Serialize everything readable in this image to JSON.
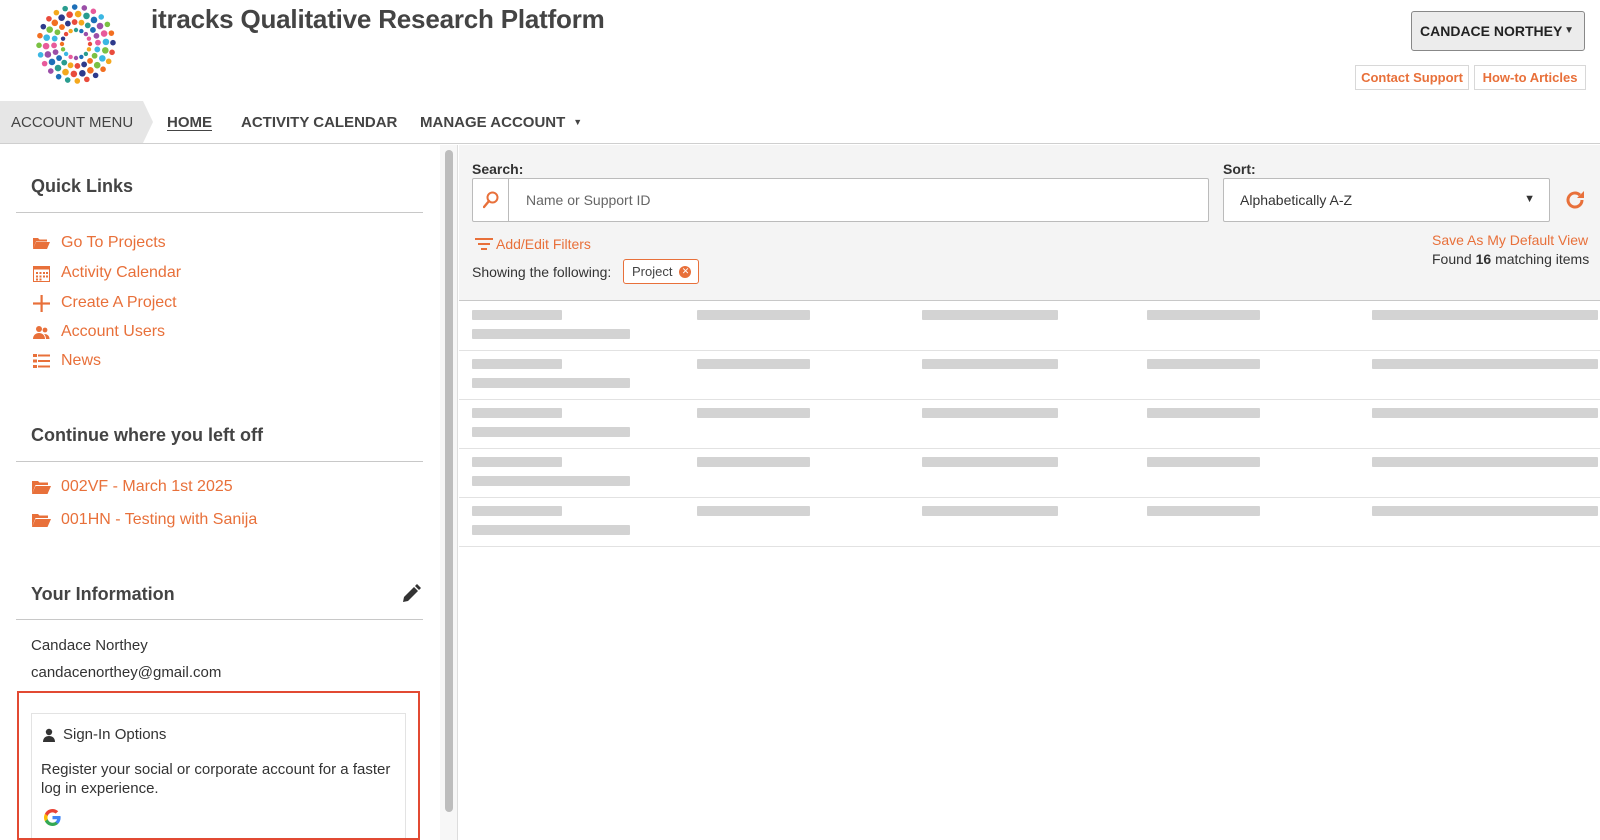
{
  "header": {
    "app_title": "itracks Qualitative Research Platform",
    "user_name": "CANDACE NORTHEY",
    "contact_support": "Contact Support",
    "how_to_articles": "How-to Articles"
  },
  "nav": {
    "account_menu": "ACCOUNT MENU",
    "items": [
      {
        "label": "HOME",
        "active": true
      },
      {
        "label": "ACTIVITY CALENDAR",
        "active": false
      },
      {
        "label": "MANAGE ACCOUNT",
        "active": false,
        "dropdown": true
      }
    ]
  },
  "quick_links": {
    "title": "Quick Links",
    "items": [
      {
        "label": "Go To Projects",
        "icon": "folder-open-icon"
      },
      {
        "label": "Activity Calendar",
        "icon": "calendar-icon"
      },
      {
        "label": "Create A Project",
        "icon": "plus-icon"
      },
      {
        "label": "Account Users",
        "icon": "users-icon"
      },
      {
        "label": "News",
        "icon": "list-icon"
      }
    ]
  },
  "continue": {
    "title": "Continue where you left off",
    "items": [
      {
        "label": "002VF - March 1st 2025",
        "icon": "folder-open-icon"
      },
      {
        "label": "001HN - Testing with Sanija",
        "icon": "folder-open-icon"
      }
    ]
  },
  "your_info": {
    "title": "Your Information",
    "name": "Candace Northey",
    "email": "candacenorthey@gmail.com",
    "signin": {
      "title": "Sign-In Options",
      "description": "Register your social or corporate account for a faster log in experience."
    }
  },
  "search": {
    "label": "Search:",
    "placeholder": "Name or Support ID",
    "value": ""
  },
  "sort": {
    "label": "Sort:",
    "selected": "Alphabetically A-Z"
  },
  "filters": {
    "add_edit_label": "Add/Edit Filters",
    "showing_label": "Showing the following:",
    "chips": [
      "Project"
    ]
  },
  "results": {
    "save_default_label": "Save As My Default View",
    "found_prefix": "Found",
    "found_count": "16",
    "found_suffix": "matching items",
    "skeleton_rows": 5
  },
  "colors": {
    "accent": "#e8703a",
    "highlight_border": "#e24a33",
    "skeleton": "#d3d3d3"
  }
}
